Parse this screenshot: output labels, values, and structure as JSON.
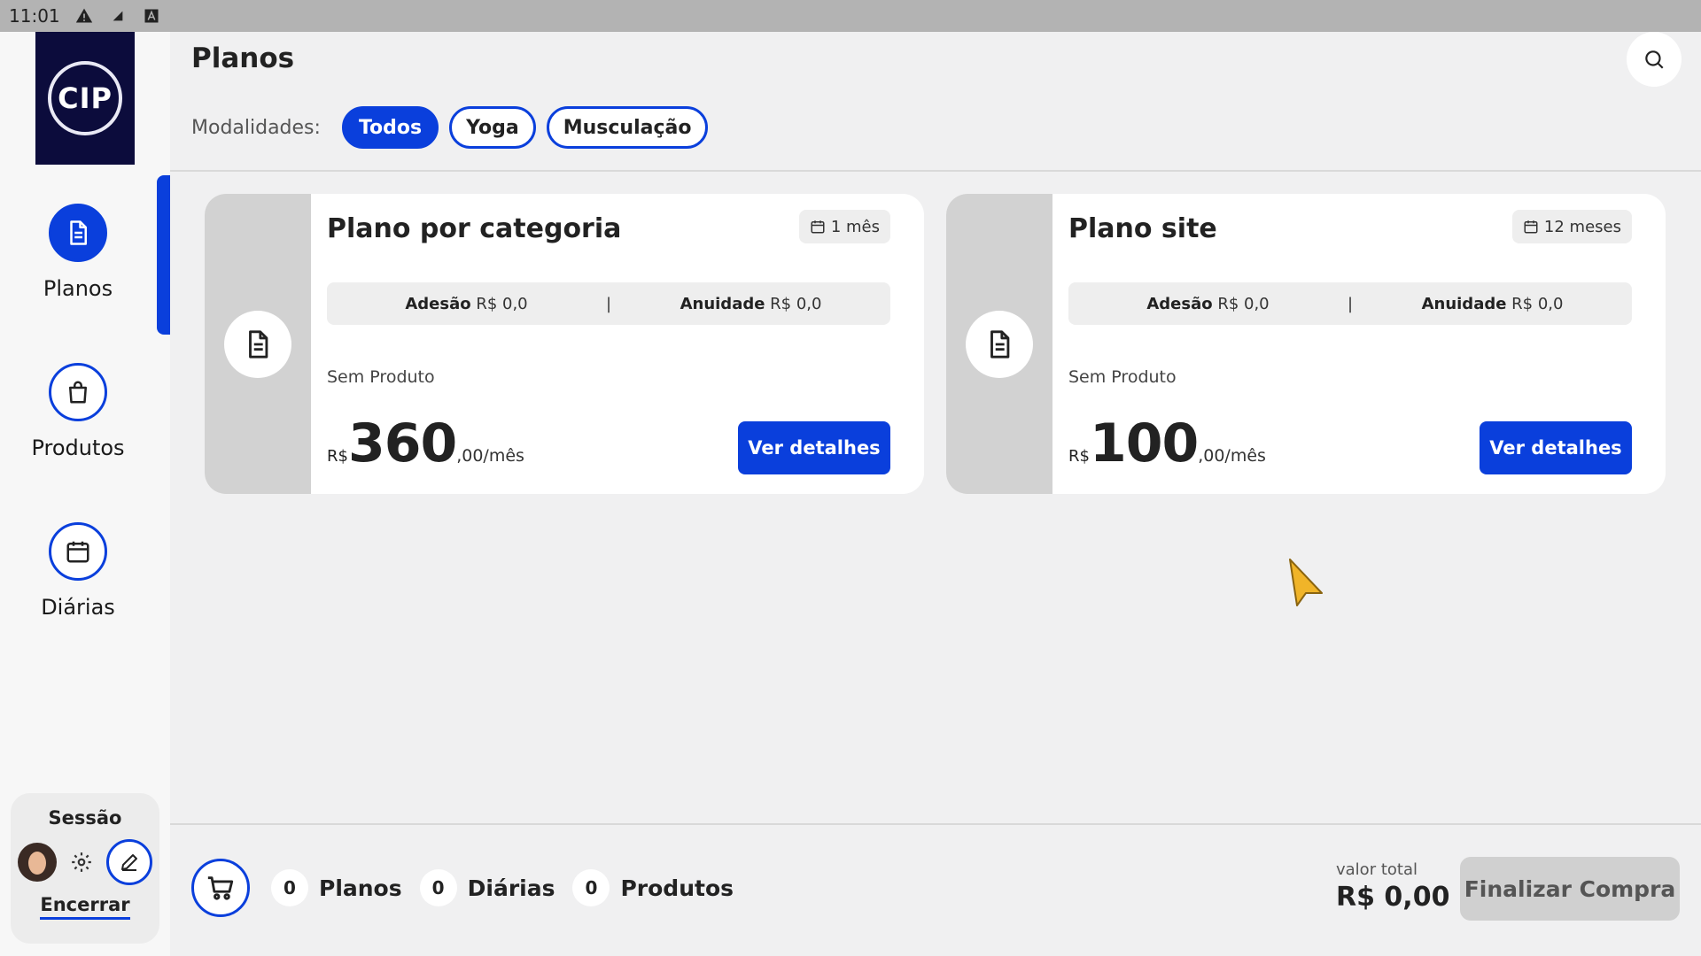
{
  "status_bar": {
    "time": "11:01",
    "icons": [
      "warning-icon",
      "signal-icon",
      "keyboard-a-icon"
    ]
  },
  "logo": {
    "text": "CIP"
  },
  "sidebar": {
    "items": [
      {
        "label": "Planos",
        "icon": "document-icon",
        "active": true
      },
      {
        "label": "Produtos",
        "icon": "shopping-bag-icon",
        "active": false
      },
      {
        "label": "Diárias",
        "icon": "calendar-icon",
        "active": false
      }
    ],
    "session": {
      "title": "Sessão",
      "logout_label": "Encerrar"
    }
  },
  "header": {
    "title": "Planos",
    "filters_label": "Modalidades:",
    "filters": [
      {
        "label": "Todos",
        "active": true
      },
      {
        "label": "Yoga",
        "active": false
      },
      {
        "label": "Musculação",
        "active": false
      }
    ]
  },
  "plans": [
    {
      "title": "Plano por categoria",
      "duration": "1 mês",
      "fee_adesao_label": "Adesão",
      "fee_adesao_value": "R$ 0,0",
      "fee_separator": "|",
      "fee_anuidade_label": "Anuidade",
      "fee_anuidade_value": "R$ 0,0",
      "product": "Sem Produto",
      "currency": "R$",
      "price_int": "360",
      "price_suffix": ",00/mês",
      "button_label": "Ver detalhes"
    },
    {
      "title": "Plano site",
      "duration": "12 meses",
      "fee_adesao_label": "Adesão",
      "fee_adesao_value": "R$ 0,0",
      "fee_separator": "|",
      "fee_anuidade_label": "Anuidade",
      "fee_anuidade_value": "R$ 0,0",
      "product": "Sem Produto",
      "currency": "R$",
      "price_int": "100",
      "price_suffix": ",00/mês",
      "button_label": "Ver detalhes"
    }
  ],
  "footer": {
    "counts": [
      {
        "count": "0",
        "label": "Planos"
      },
      {
        "count": "0",
        "label": "Diárias"
      },
      {
        "count": "0",
        "label": "Produtos"
      }
    ],
    "total_label": "valor total",
    "total_value": "R$ 0,00",
    "checkout_label": "Finalizar Compra"
  },
  "colors": {
    "accent": "#0a3fdc",
    "background": "#f0f0f1",
    "card_side": "#d2d2d2",
    "disabled": "#d0d0d0"
  }
}
